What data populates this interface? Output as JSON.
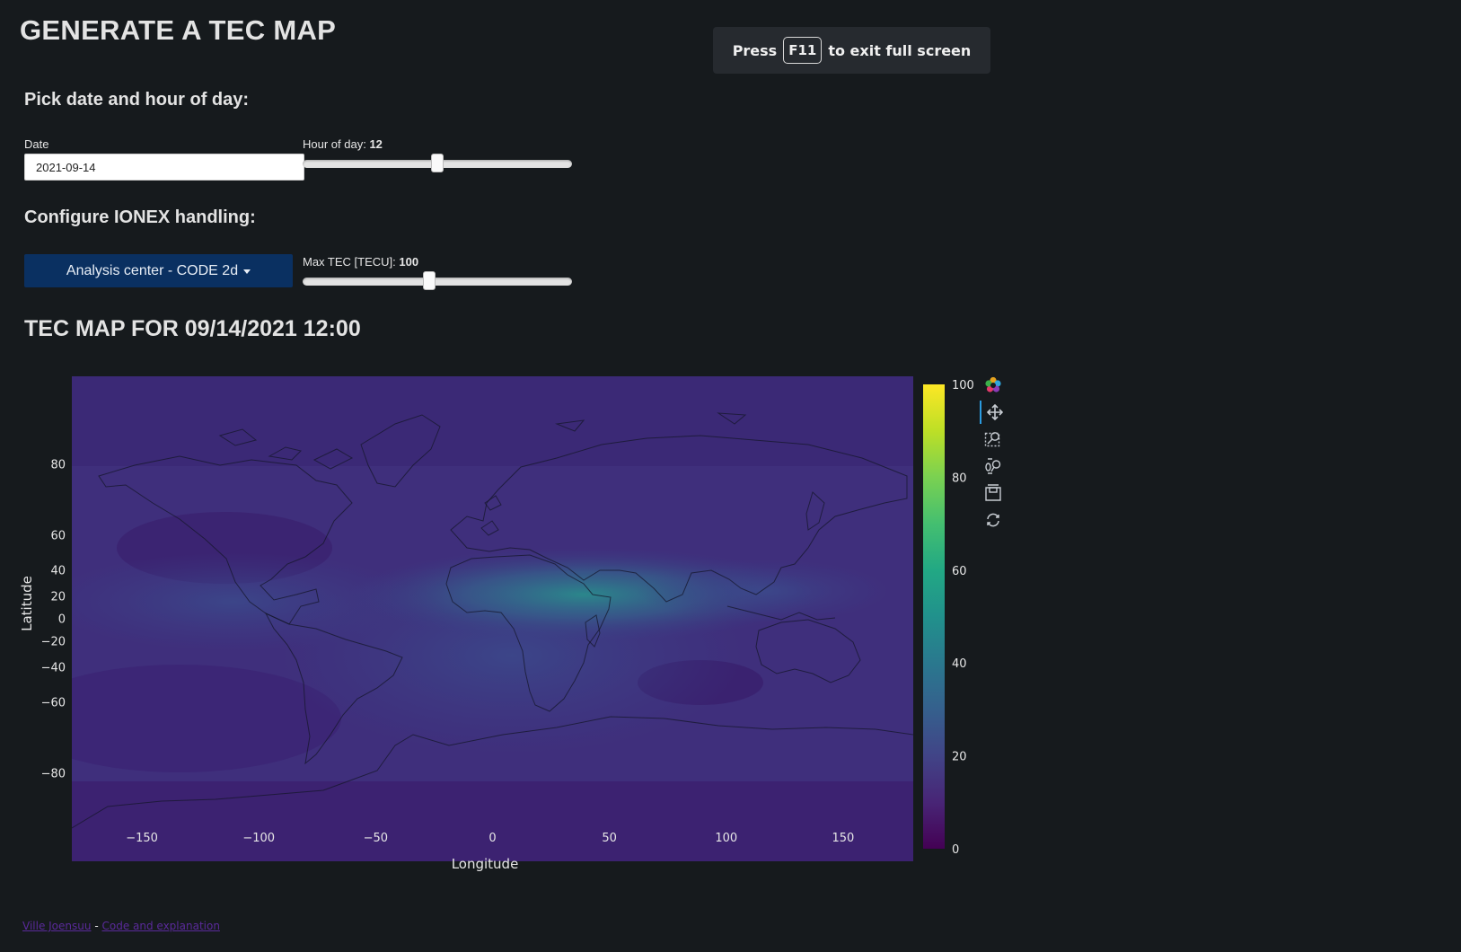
{
  "header": {
    "title": "GENERATE A TEC MAP",
    "fullscreen_notice": {
      "prefix": "Press",
      "key": "F11",
      "suffix": "to exit full screen"
    }
  },
  "date_section": {
    "heading": "Pick date and hour of day:",
    "date_label": "Date",
    "date_value": "2021-09-14",
    "hour_label": "Hour of day:",
    "hour_value": "12",
    "hour_fraction": 0.5
  },
  "ionex_section": {
    "heading": "Configure IONEX handling:",
    "center_button_label": "Analysis center - CODE 2d",
    "max_tec_label": "Max TEC [TECU]:",
    "max_tec_value": "100",
    "max_tec_fraction": 0.47
  },
  "map": {
    "title": "TEC MAP FOR 09/14/2021 12:00"
  },
  "chart_data": {
    "type": "heatmap",
    "title": "",
    "xlabel": "Longitude",
    "ylabel": "Latitude",
    "xlim": [
      -180,
      180
    ],
    "ylim": [
      -87.5,
      87.5
    ],
    "x_ticks": [
      -150,
      -100,
      -50,
      0,
      50,
      100,
      150
    ],
    "x_tick_labels": [
      "−150",
      "−100",
      "−50",
      "0",
      "50",
      "100",
      "150"
    ],
    "y_ticks": [
      80,
      60,
      40,
      20,
      0,
      -20,
      -40,
      -60,
      -80
    ],
    "y_tick_labels": [
      "80",
      "60",
      "40",
      "20",
      "0",
      "−20",
      "−40",
      "−60",
      "−80"
    ],
    "colorbar": {
      "colormap": "viridis",
      "range": [
        0,
        100
      ],
      "ticks": [
        0,
        20,
        40,
        60,
        80,
        100
      ],
      "tick_labels": [
        "0",
        "20",
        "40",
        "60",
        "80",
        "100"
      ]
    },
    "overlay": "coastlines"
  },
  "toolbar": {
    "tools": [
      {
        "icon": "bokeh-logo-icon"
      },
      {
        "icon": "pan-icon",
        "active": true
      },
      {
        "icon": "box-zoom-icon"
      },
      {
        "icon": "wheel-zoom-icon"
      },
      {
        "icon": "save-icon"
      },
      {
        "icon": "reset-icon"
      }
    ]
  },
  "footer": {
    "author_link": "Ville Joensuu",
    "separator": "-",
    "code_link": "Code and explanation"
  },
  "colors": {
    "background": "#161a1d",
    "button": "#0a3061",
    "notice_bg": "#262a2f",
    "link": "#5a2a9a"
  }
}
